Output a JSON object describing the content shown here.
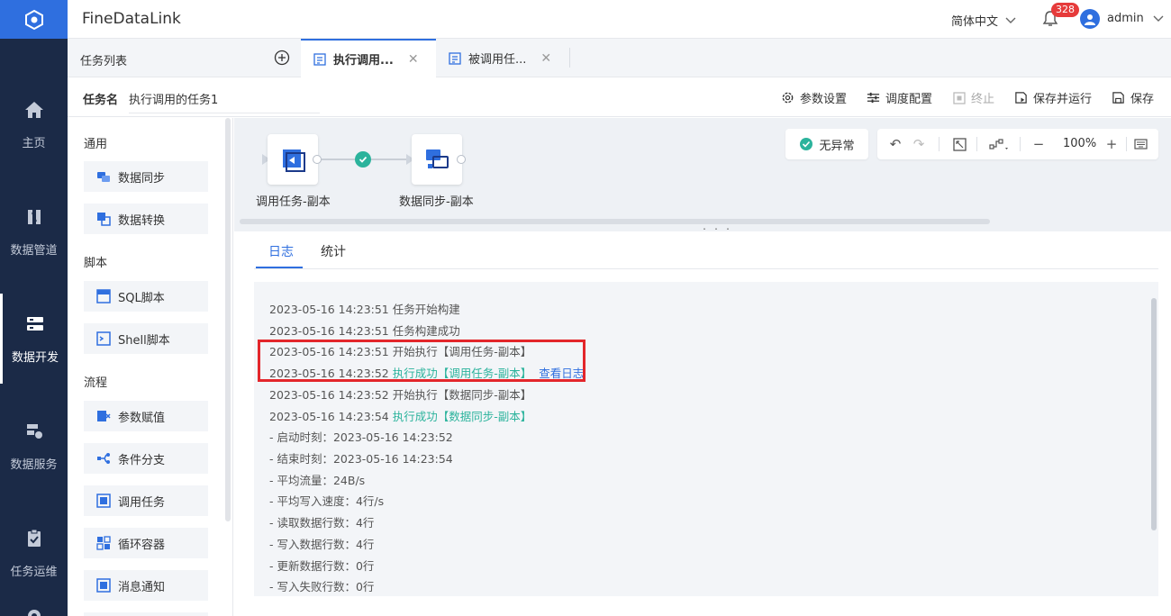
{
  "app": {
    "title": "FineDataLink",
    "language": "简体中文",
    "notifications": "328",
    "user": "admin"
  },
  "leftnav": [
    {
      "label": "主页",
      "icon": "home-icon"
    },
    {
      "label": "数据管道",
      "icon": "pipeline-icon"
    },
    {
      "label": "数据开发",
      "icon": "data-dev-icon",
      "active": true
    },
    {
      "label": "数据服务",
      "icon": "data-service-icon"
    },
    {
      "label": "任务运维",
      "icon": "task-ops-icon"
    }
  ],
  "tabstrip": {
    "tasklist": "任务列表",
    "tabs": [
      {
        "label": "执行调用...",
        "icon": "task-file-icon",
        "active": true
      },
      {
        "label": "被调用任...",
        "icon": "task-file-icon",
        "active": false
      }
    ]
  },
  "taskbar": {
    "name_label": "任务名",
    "name_value": "执行调用的任务1",
    "buttons": {
      "params": "参数设置",
      "schedule": "调度配置",
      "stop": "终止",
      "save_run": "保存并运行",
      "save": "保存"
    }
  },
  "palette": {
    "sections": {
      "general": "通用",
      "script": "脚本",
      "flow": "流程"
    },
    "items": {
      "data_sync": "数据同步",
      "data_transform": "数据转换",
      "sql_script": "SQL脚本",
      "shell_script": "Shell脚本",
      "param_assign": "参数赋值",
      "condition_branch": "条件分支",
      "invoke_task": "调用任务",
      "loop_container": "循环容器",
      "message_notify": "消息通知"
    }
  },
  "canvas": {
    "status": "无异常",
    "zoom": "100%",
    "nodes": [
      {
        "label": "调用任务-副本",
        "icon": "invoke-task-icon"
      },
      {
        "label": "数据同步-副本",
        "icon": "data-sync-icon"
      }
    ],
    "edge_status": "success"
  },
  "log": {
    "tabs": {
      "log": "日志",
      "stats": "统计"
    },
    "lines": [
      {
        "text": "2023-05-16 14:23:51  任务开始构建"
      },
      {
        "text": "2023-05-16 14:23:51  任务构建成功"
      },
      {
        "text": "2023-05-16 14:23:51  开始执行【调用任务-副本】"
      },
      {
        "prefix": "2023-05-16 14:23:52  ",
        "ok": "执行成功【调用任务-副本】",
        "link": "查看日志"
      },
      {
        "text": "2023-05-16 14:23:52  开始执行【数据同步-副本】"
      },
      {
        "prefix": "2023-05-16 14:23:54  ",
        "ok": "执行成功【数据同步-副本】"
      },
      {
        "text": "- 启动时刻：2023-05-16 14:23:52"
      },
      {
        "text": "- 结束时刻：2023-05-16 14:23:54"
      },
      {
        "text": "- 平均流量：24B/s"
      },
      {
        "text": "- 平均写入速度：4行/s"
      },
      {
        "text": "- 读取数据行数：4行"
      },
      {
        "text": "- 写入数据行数：4行"
      },
      {
        "text": "- 更新数据行数：0行"
      },
      {
        "text": "- 写入失败行数：0行"
      }
    ]
  },
  "colors": {
    "accent": "#2f6fdf",
    "success": "#2bb39c",
    "nav_bg": "#1b2a47",
    "highlight": "#e3262b"
  }
}
